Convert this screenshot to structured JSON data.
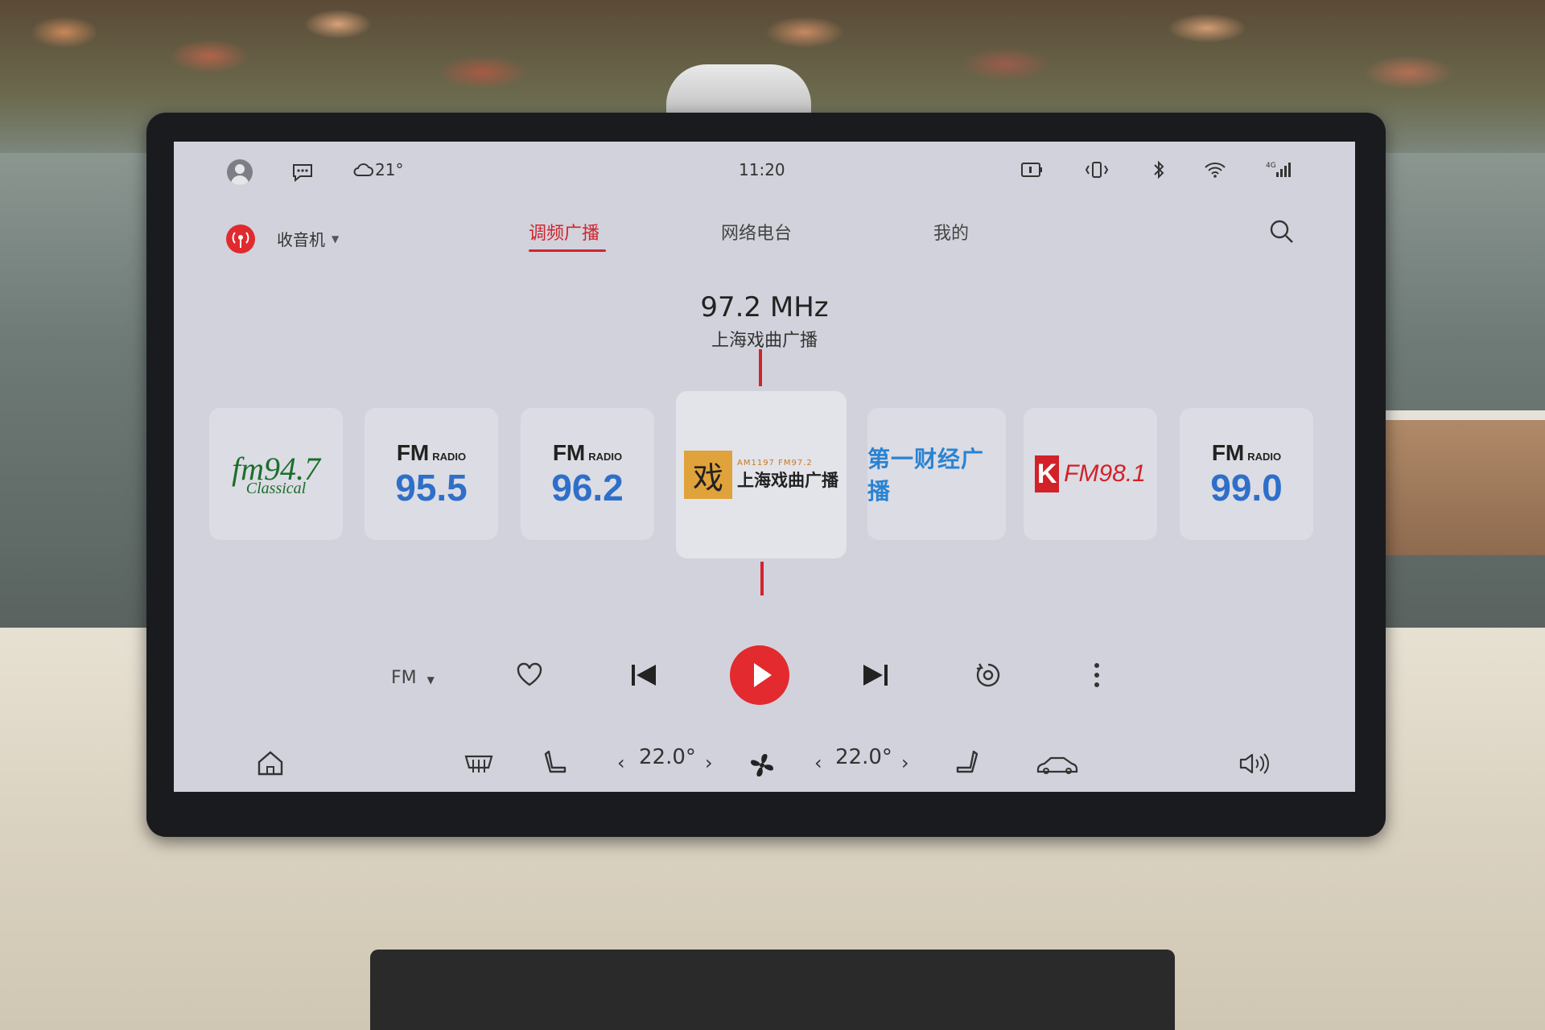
{
  "status_bar": {
    "weather_temp": "21°",
    "time": "11:20",
    "network_label": "4G"
  },
  "header": {
    "app_label": "收音机",
    "tabs": [
      {
        "label": "调频广播",
        "active": true
      },
      {
        "label": "网络电台",
        "active": false
      },
      {
        "label": "我的",
        "active": false
      }
    ]
  },
  "now_playing": {
    "frequency": "97.2 MHz",
    "station": "上海戏曲广播"
  },
  "stations": [
    {
      "type": "logo",
      "text": "fm94.7",
      "sub": "Classical"
    },
    {
      "type": "fm",
      "top": "FM",
      "tag": "RADIO",
      "num": "95.5"
    },
    {
      "type": "fm",
      "top": "FM",
      "tag": "RADIO",
      "num": "96.2"
    },
    {
      "type": "logo",
      "text": "上海戏曲广播",
      "sub": "AM1197 FM97.2"
    },
    {
      "type": "logo",
      "text": "第一财经广播"
    },
    {
      "type": "logo",
      "text": "FM98.1"
    },
    {
      "type": "fm",
      "top": "FM",
      "tag": "RADIO",
      "num": "99.0"
    }
  ],
  "controls": {
    "band": "FM"
  },
  "dock": {
    "temp_left": "22.0°",
    "temp_right": "22.0°"
  },
  "colors": {
    "accent": "#d2242d",
    "fm_blue": "#2e6fc9",
    "screen_bg": "#d2d2dc"
  }
}
